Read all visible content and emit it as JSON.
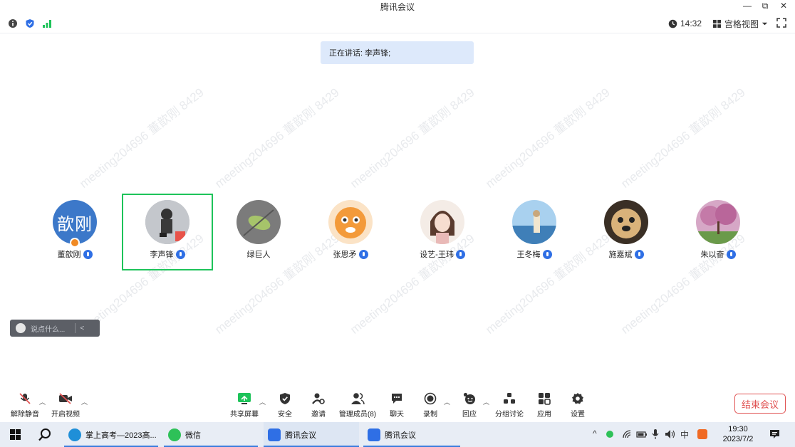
{
  "window": {
    "title": "腾讯会议",
    "minimize": "—",
    "restore": "⧉",
    "close": "✕"
  },
  "status": {
    "time": "14:32",
    "view_label": "宫格视图"
  },
  "speaking": {
    "text": "正在讲话: 李声锋;"
  },
  "watermark": "meeting204696 董歆刚 8429",
  "participants": [
    {
      "name": "董歆刚",
      "avatar_text": "歆刚",
      "avatar_color": "#3c78c9",
      "host": true,
      "active": false,
      "mic": true
    },
    {
      "name": "李声锋",
      "avatar_color": "#b9bcc3",
      "host": false,
      "active": true,
      "mic": true
    },
    {
      "name": "绿巨人",
      "avatar_color": "#6e6e6e",
      "host": false,
      "active": false,
      "mic": false
    },
    {
      "name": "张思矛",
      "avatar_color": "#f3b26a",
      "host": false,
      "active": false,
      "mic": true
    },
    {
      "name": "设艺-王玮",
      "avatar_color": "#e7d9d0",
      "host": false,
      "active": false,
      "mic": true
    },
    {
      "name": "王冬梅",
      "avatar_color": "#7fb2d9",
      "host": false,
      "active": false,
      "mic": true
    },
    {
      "name": "施嘉斌",
      "avatar_color": "#c9a76a",
      "host": false,
      "active": false,
      "mic": true
    },
    {
      "name": "朱以奋",
      "avatar_color": "#c98fb0",
      "host": false,
      "active": false,
      "mic": true
    }
  ],
  "chat": {
    "placeholder": "说点什么...",
    "collapse": "<"
  },
  "toolbar": {
    "unmute": "解除静音",
    "start_video": "开启视频",
    "share_screen": "共享屏幕",
    "security": "安全",
    "invite": "邀请",
    "members": "管理成员(8)",
    "chat": "聊天",
    "record": "录制",
    "react": "回应",
    "breakout": "分组讨论",
    "apps": "应用",
    "settings": "设置",
    "end_meeting": "结束会议",
    "accent": "#2f6fe5",
    "end_color": "#e05252"
  },
  "taskbar": {
    "apps": [
      {
        "label": "掌上高考—2023高..."
      },
      {
        "label": "微信"
      },
      {
        "label": "腾讯会议"
      },
      {
        "label": "腾讯会议"
      }
    ],
    "ime": "中",
    "clock_time": "19:30",
    "clock_date": "2023/7/2"
  }
}
